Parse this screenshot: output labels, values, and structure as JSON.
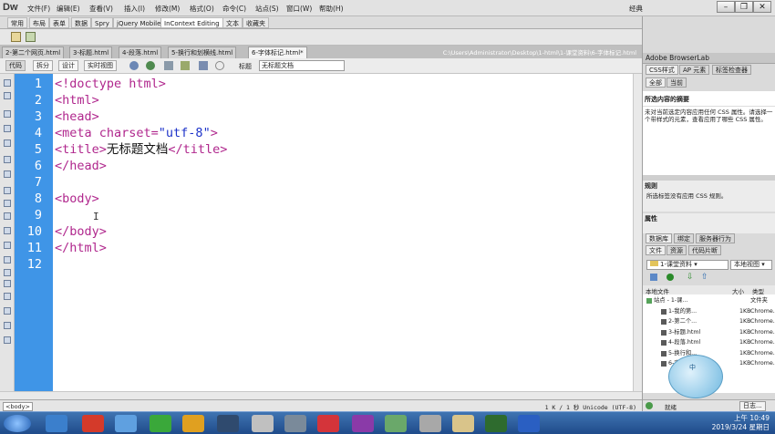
{
  "app": {
    "logo": "Dw"
  },
  "menu": [
    "文件(F)",
    "编辑(E)",
    "查看(V)",
    "插入(I)",
    "修改(M)",
    "格式(O)",
    "命令(C)",
    "站点(S)",
    "窗口(W)",
    "帮助(H)"
  ],
  "workspace": "经典",
  "insert_categories": [
    "常用",
    "布局",
    "表单",
    "数据",
    "Spry",
    "jQuery Mobile",
    "InContext Editing",
    "文本",
    "收藏夹"
  ],
  "active_category": 6,
  "doc_tabs": [
    "2-第二个网页.html",
    "3-标题.html",
    "4-段落.html",
    "5-换行和划横线.html",
    "6-字体标记.html*"
  ],
  "active_doc": 4,
  "doc_path": "C:\\Users\\Administrator\\Desktop\\1-html\\1-课堂资料\\6-字体标记.html",
  "view_buttons": [
    "代码",
    "拆分",
    "设计",
    "实时视图"
  ],
  "active_view": 0,
  "title_label": "标题",
  "title_value": "无标题文档",
  "line_numbers": [
    "1",
    "2",
    "3",
    "4",
    "5",
    "6",
    "7",
    "8",
    "9",
    "10",
    "11",
    "12"
  ],
  "code_lines": [
    [
      {
        "t": "<!doctype html>",
        "c": "tag"
      }
    ],
    [
      {
        "t": "<html>",
        "c": "tag"
      }
    ],
    [
      {
        "t": "<head>",
        "c": "tag"
      }
    ],
    [
      {
        "t": "<meta charset=",
        "c": "tag"
      },
      {
        "t": "\"utf-8\"",
        "c": "str"
      },
      {
        "t": ">",
        "c": "tag"
      }
    ],
    [
      {
        "t": "<title>",
        "c": "tag"
      },
      {
        "t": "无标题文档",
        "c": "txt"
      },
      {
        "t": "</title>",
        "c": "tag"
      }
    ],
    [
      {
        "t": "</head>",
        "c": "tag"
      }
    ],
    [],
    [
      {
        "t": "<body>",
        "c": "tag"
      }
    ],
    [],
    [
      {
        "t": "</body>",
        "c": "tag"
      }
    ],
    [
      {
        "t": "</html>",
        "c": "tag"
      }
    ],
    []
  ],
  "status_left": "<body>",
  "status_right": "1 K / 1 秒  Unicode (UTF-8)",
  "panels": {
    "browserlab": "Adobe BrowserLab",
    "css_tabs": [
      "CSS样式",
      "AP 元素",
      "标签检查器"
    ],
    "css_subtabs": [
      "全部",
      "当前"
    ],
    "summary_title": "所选内容的摘要",
    "summary_text": "未对当前选定内容应用任何 CSS 属性。请选择一个带样式的元素，查看应用了哪些 CSS 属性。",
    "rules_title": "规则",
    "rules_text": "所选标签没有应用 CSS 规则。",
    "props_title": "属性",
    "db_tabs": [
      "数据库",
      "绑定",
      "服务器行为"
    ],
    "file_tabs": [
      "文件",
      "资源",
      "代码片断"
    ],
    "site_select": "1-课堂资料",
    "view_select": "本地视图",
    "col_headers": [
      "本地文件",
      "大小",
      "类型"
    ],
    "files": [
      {
        "name": "站点 - 1-课...",
        "size": "",
        "type": "文件夹"
      },
      {
        "name": "1-我的第...",
        "size": "1KB",
        "type": "Chrome..."
      },
      {
        "name": "2-第二个...",
        "size": "1KB",
        "type": "Chrome..."
      },
      {
        "name": "3-标题.html",
        "size": "1KB",
        "type": "Chrome..."
      },
      {
        "name": "4-段落.html",
        "size": "1KB",
        "type": "Chrome..."
      },
      {
        "name": "5-换行和...",
        "size": "1KB",
        "type": "Chrome..."
      },
      {
        "name": "6-字体标...",
        "size": "1KB",
        "type": "Chrome..."
      }
    ],
    "footer_ready": "就绪",
    "footer_log": "日志..."
  },
  "tray": {
    "time": "上午 10:49",
    "date": "2019/3/24 星期日"
  },
  "colors": {
    "gutter": "#3f95e7",
    "tag": "#b0278d",
    "string": "#1d33c9"
  }
}
